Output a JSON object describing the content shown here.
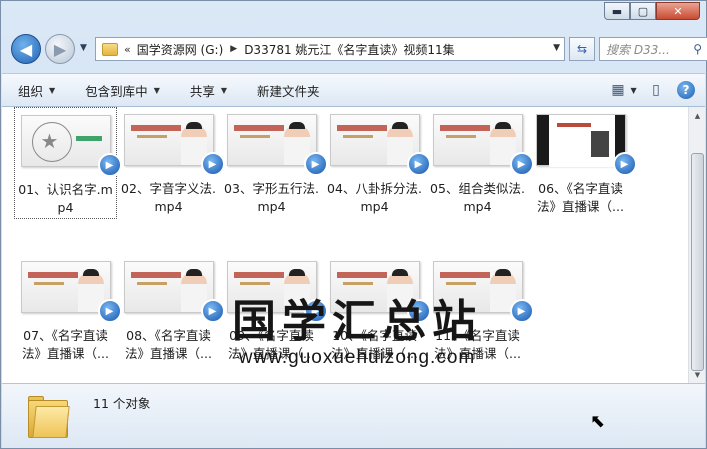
{
  "window": {
    "caption_buttons": {
      "minimize": "▬",
      "maximize": "▢",
      "close": "✕"
    }
  },
  "nav": {
    "back_icon": "◀",
    "forward_icon": "▶",
    "history_icon": "▼",
    "breadcrumb_overflow": "«",
    "breadcrumbs": [
      "国学资源网 (G:)",
      "D33781 姚元江《名字直读》视频11集"
    ],
    "separator": "▶",
    "address_dropdown": "▼",
    "refresh_icon": "⇆",
    "search_placeholder": "搜索 D33...",
    "search_icon": "⚲"
  },
  "toolbar": {
    "items": [
      {
        "label": "组织",
        "has_dropdown": true
      },
      {
        "label": "包含到库中",
        "has_dropdown": true
      },
      {
        "label": "共享",
        "has_dropdown": true
      },
      {
        "label": "新建文件夹",
        "has_dropdown": false
      }
    ],
    "dropdown_arrow": "▼",
    "view_icon": "▦",
    "view_arrow": "▼",
    "preview_pane_icon": "▯",
    "help_icon": "?"
  },
  "files": [
    {
      "label": "01、认识名字.mp4",
      "thumb": "diagram",
      "selected": true
    },
    {
      "label": "02、字音字义法.mp4",
      "thumb": "title",
      "selected": false
    },
    {
      "label": "03、字形五行法.mp4",
      "thumb": "title",
      "selected": false
    },
    {
      "label": "04、八卦拆分法.mp4",
      "thumb": "title",
      "selected": false
    },
    {
      "label": "05、组合类似法.mp4",
      "thumb": "title",
      "selected": false
    },
    {
      "label": "06、《名字直读法》直播课（...",
      "thumb": "dark",
      "selected": false
    },
    {
      "label": "07、《名字直读法》直播课（...",
      "thumb": "title",
      "selected": false
    },
    {
      "label": "08、《名字直读法》直播课（...",
      "thumb": "title",
      "selected": false
    },
    {
      "label": "09、《名字直读法》直播课（...",
      "thumb": "title",
      "selected": false
    },
    {
      "label": "10、《名字直读法》直播课（...",
      "thumb": "title",
      "selected": false
    },
    {
      "label": "11、《名字直读法》直播课（...",
      "thumb": "title",
      "selected": false
    }
  ],
  "play_badge_icon": "▶",
  "watermark": {
    "text": "国学汇总站",
    "url": "www.guoxuehuizong.com"
  },
  "status": {
    "count_text": "11 个对象"
  },
  "scrollbar": {
    "up": "▲",
    "down": "▼"
  },
  "cursor_icon": "⬉"
}
